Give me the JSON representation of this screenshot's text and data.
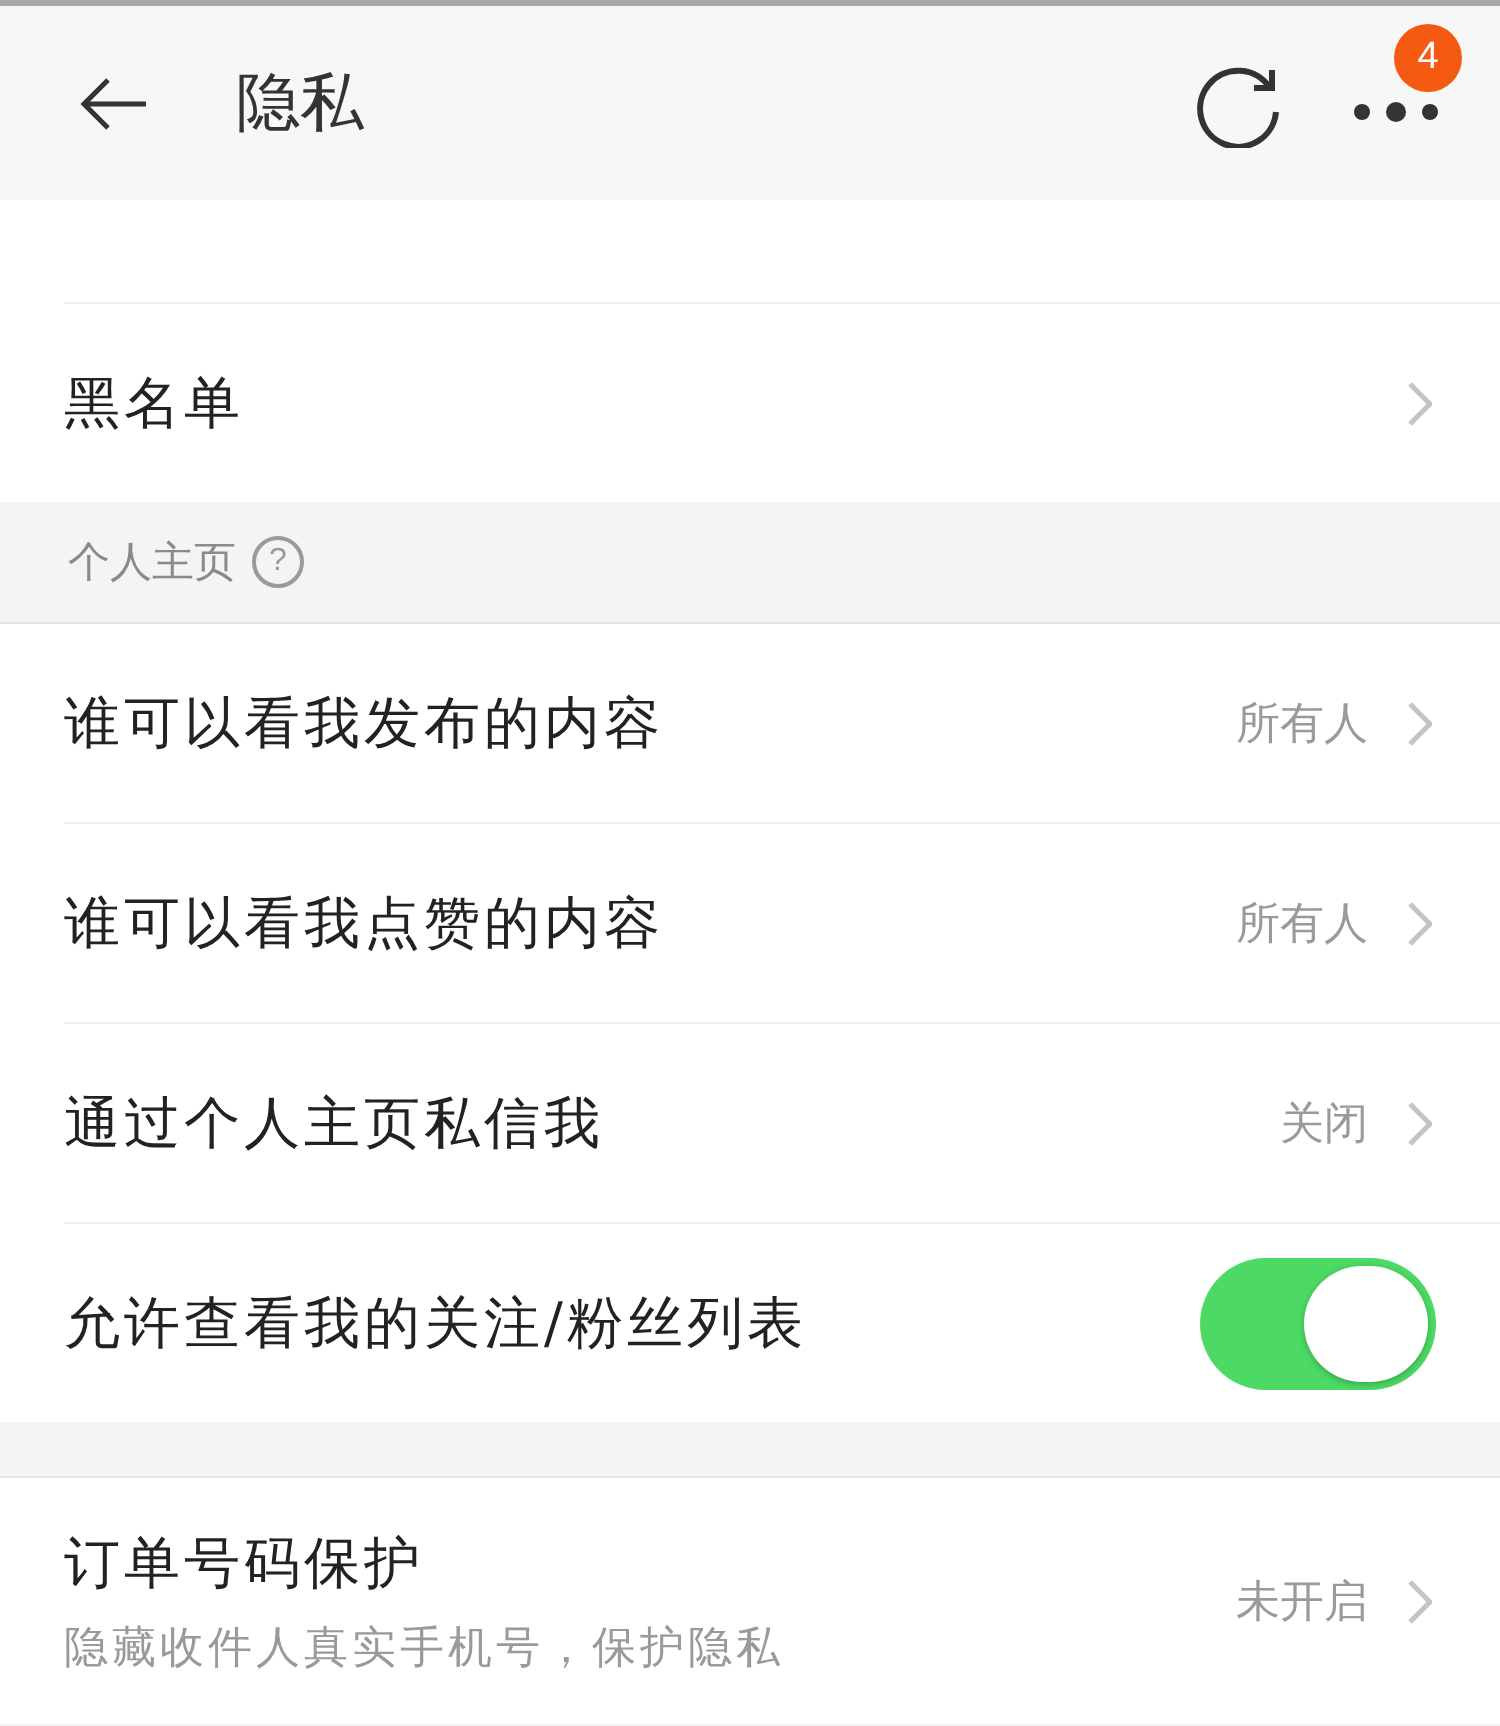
{
  "header": {
    "title": "隐私",
    "badge": "4"
  },
  "groups": [
    {
      "rows": [
        {
          "kind": "link",
          "label": "黑名单"
        }
      ]
    },
    {
      "title": "个人主页",
      "help": "?",
      "rows": [
        {
          "kind": "link",
          "label": "谁可以看我发布的内容",
          "value": "所有人"
        },
        {
          "kind": "link",
          "label": "谁可以看我点赞的内容",
          "value": "所有人"
        },
        {
          "kind": "link",
          "label": "通过个人主页私信我",
          "value": "关闭"
        },
        {
          "kind": "toggle",
          "label": "允许查看我的关注/粉丝列表",
          "on": true
        }
      ]
    },
    {
      "rows": [
        {
          "kind": "link",
          "label": "订单号码保护",
          "description": "隐藏收件人真实手机号，保护隐私",
          "value": "未开启"
        }
      ]
    }
  ]
}
